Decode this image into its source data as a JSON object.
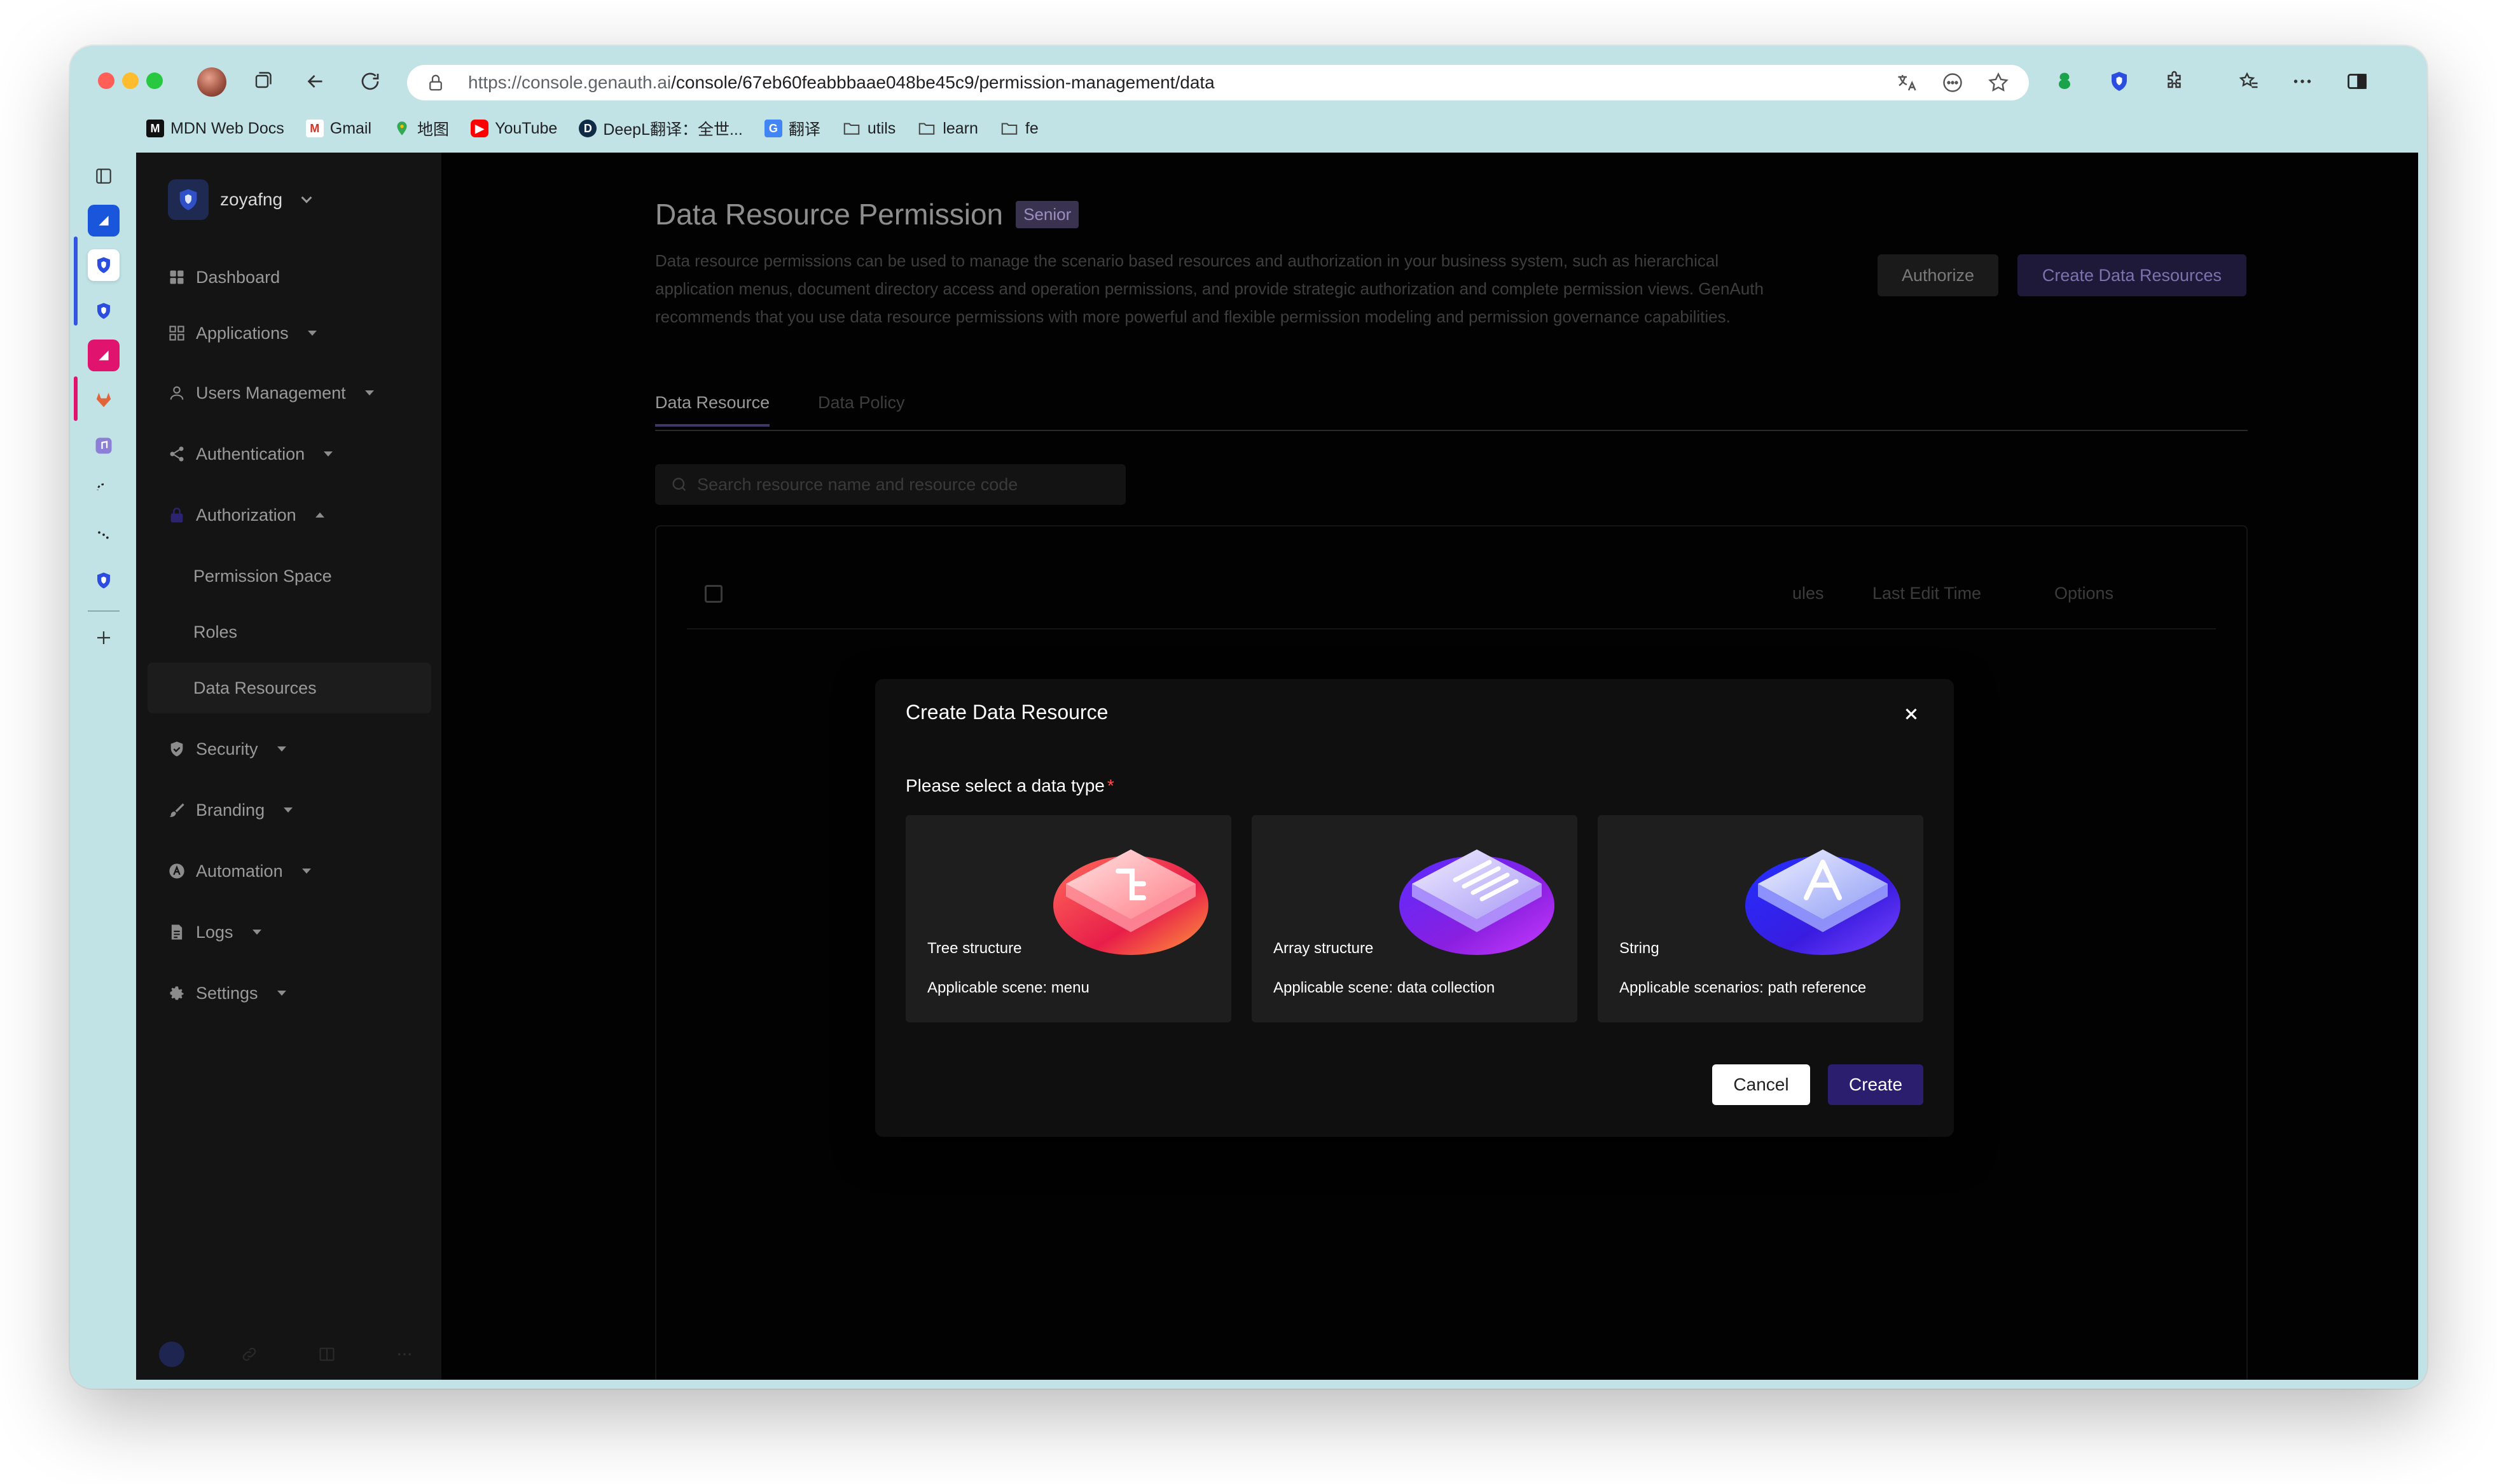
{
  "browser": {
    "url_host": "https://console.genauth.ai",
    "url_path": "/console/67eb60feabbbaae048be45c9/permission-management/data",
    "bookmarks": [
      {
        "label": "MDN Web Docs",
        "icon": "mdn-icon"
      },
      {
        "label": "Gmail",
        "icon": "gmail-icon"
      },
      {
        "label": "地图",
        "icon": "maps-icon"
      },
      {
        "label": "YouTube",
        "icon": "youtube-icon"
      },
      {
        "label": "DeepL翻译：全世...",
        "icon": "deepl-icon"
      },
      {
        "label": "翻译",
        "icon": "translate-icon"
      },
      {
        "label": "utils",
        "icon": "folder-icon"
      },
      {
        "label": "learn",
        "icon": "folder-icon"
      },
      {
        "label": "fe",
        "icon": "folder-icon"
      }
    ]
  },
  "sidebar": {
    "org_name": "zoyafng",
    "items": {
      "dashboard": "Dashboard",
      "applications": "Applications",
      "users": "Users Management",
      "authentication": "Authentication",
      "authorization": "Authorization",
      "permission_space": "Permission Space",
      "roles": "Roles",
      "data_resources": "Data Resources",
      "security": "Security",
      "branding": "Branding",
      "automation": "Automation",
      "logs": "Logs",
      "settings": "Settings"
    }
  },
  "main": {
    "title": "Data Resource Permission",
    "badge": "Senior",
    "description": "Data resource permissions can be used to manage the scenario based resources and authorization in your business system, such as hierarchical application menus, document directory access and operation permissions, and provide strategic authorization and complete permission views. GenAuth recommends that you use data resource permissions with more powerful and flexible permission modeling and permission governance capabilities.",
    "authorize_label": "Authorize",
    "create_label": "Create Data Resources",
    "tabs": [
      "Data Resource",
      "Data Policy"
    ],
    "search_placeholder": "Search resource name and resource code",
    "columns": {
      "rules": "ules",
      "last_edit": "Last Edit Time",
      "options": "Options"
    }
  },
  "modal": {
    "title": "Create Data Resource",
    "label": "Please select a data type",
    "required_mark": "*",
    "cards": [
      {
        "title": "Tree structure",
        "scene": "Applicable scene: menu"
      },
      {
        "title": "Array structure",
        "scene": "Applicable scene: data collection"
      },
      {
        "title": "String",
        "scene": "Applicable scenarios: path reference"
      }
    ],
    "cancel_label": "Cancel",
    "create_label": "Create"
  },
  "colors": {
    "accent": "#2c1e6e",
    "modal_bg": "#0f0f10",
    "card_bg": "#1e1e1f",
    "required": "#ff4d4f"
  }
}
